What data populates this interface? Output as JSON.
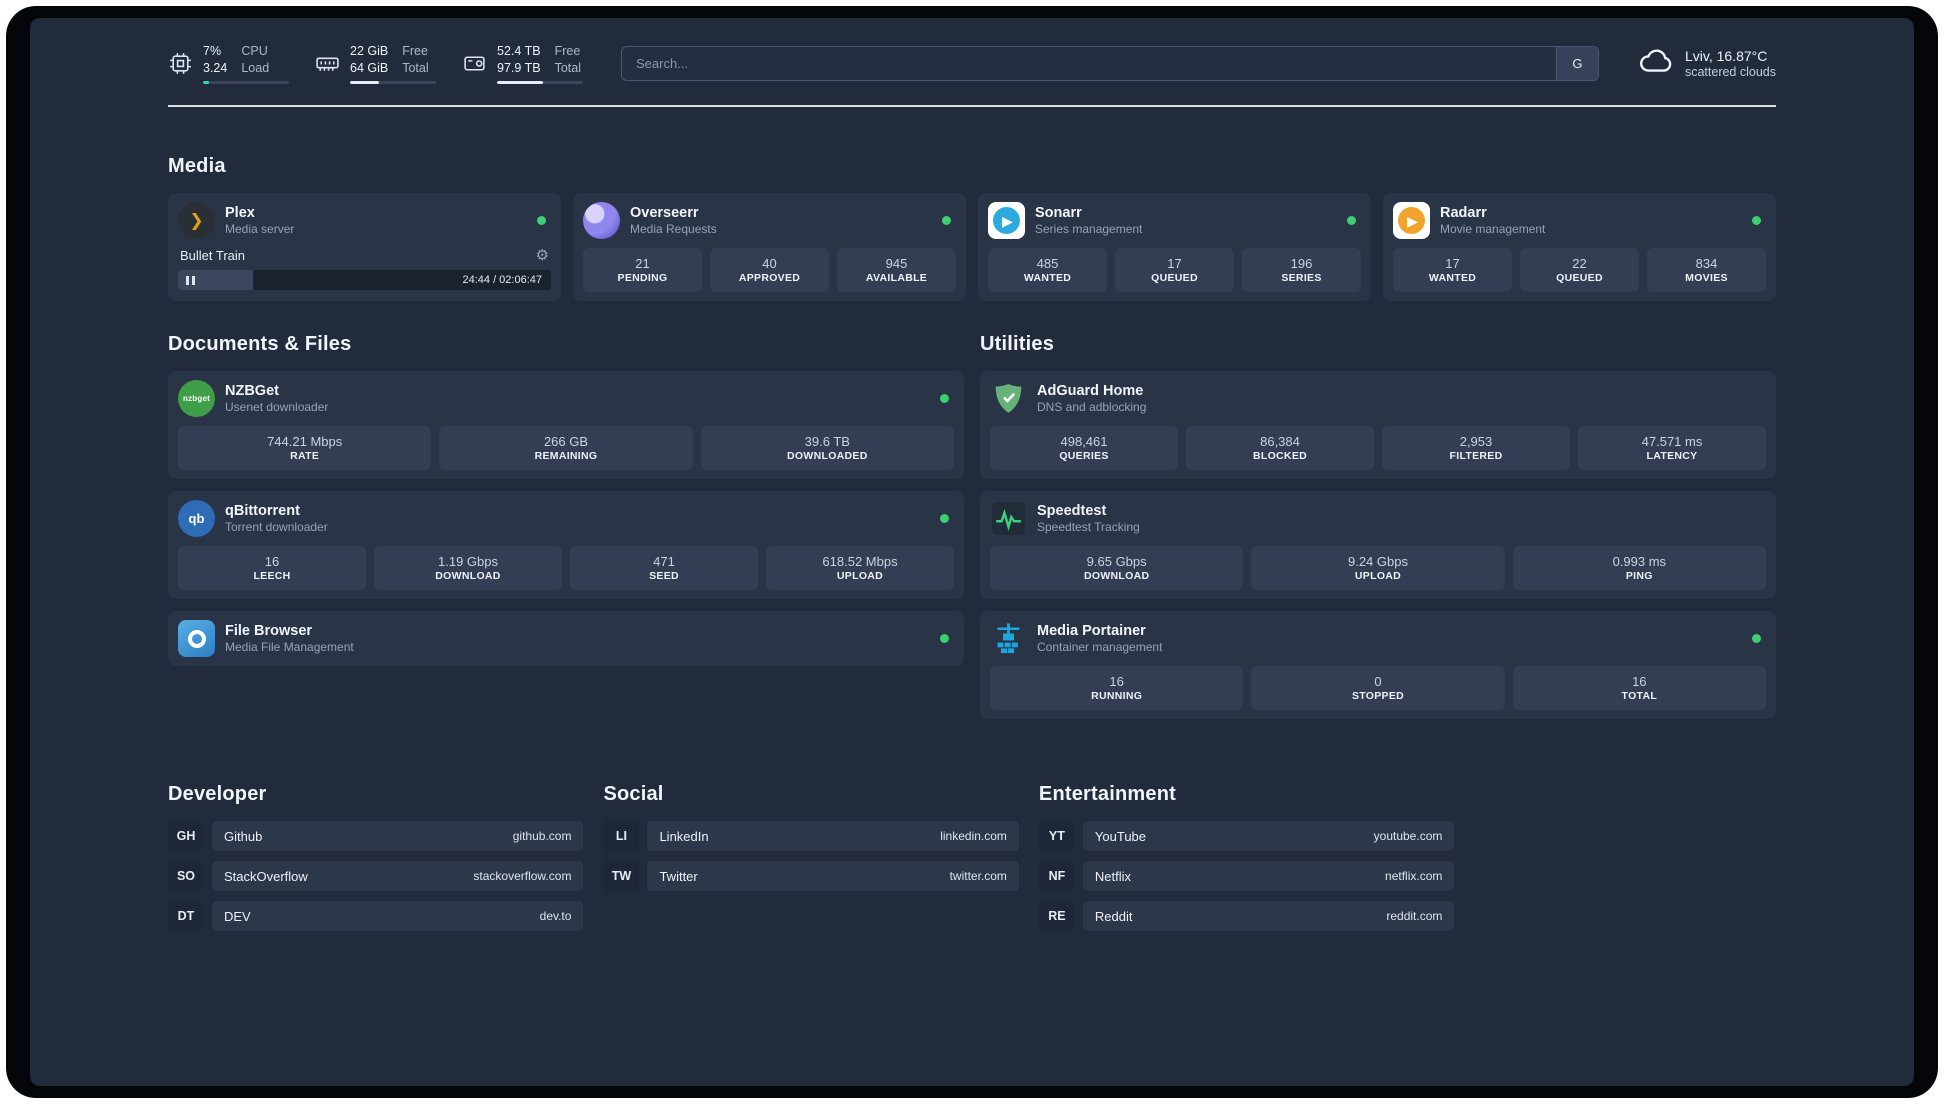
{
  "theme": {
    "status_green": "#3ecf72",
    "cpu_bar_color": "#2fd3b0",
    "ram_bar_color": "#e8edf5",
    "disk_bar_color": "#e8edf5"
  },
  "topbar": {
    "cpu": {
      "line1": "7%",
      "line2": "3.24",
      "label1": "CPU",
      "label2": "Load",
      "progress_pct": 7
    },
    "ram": {
      "line1": "22 GiB",
      "line2": "64 GiB",
      "label1": "Free",
      "label2": "Total",
      "progress_pct": 34
    },
    "disk": {
      "line1": "52.4 TB",
      "line2": "97.9 TB",
      "label1": "Free",
      "label2": "Total",
      "progress_pct": 53
    },
    "search": {
      "placeholder": "Search...",
      "engine_label": "G"
    },
    "weather": {
      "location": "Lviv, 16.87°C",
      "condition": "scattered clouds"
    }
  },
  "sections": {
    "media": {
      "title": "Media",
      "plex": {
        "title": "Plex",
        "subtitle": "Media server",
        "player": {
          "track": "Bullet Train",
          "time": "24:44 / 02:06:47",
          "progress_pct": 20
        }
      },
      "overseerr": {
        "title": "Overseerr",
        "subtitle": "Media Requests",
        "stats": [
          {
            "value": "21",
            "label": "PENDING"
          },
          {
            "value": "40",
            "label": "APPROVED"
          },
          {
            "value": "945",
            "label": "AVAILABLE"
          }
        ]
      },
      "sonarr": {
        "title": "Sonarr",
        "subtitle": "Series management",
        "stats": [
          {
            "value": "485",
            "label": "WANTED"
          },
          {
            "value": "17",
            "label": "QUEUED"
          },
          {
            "value": "196",
            "label": "SERIES"
          }
        ]
      },
      "radarr": {
        "title": "Radarr",
        "subtitle": "Movie management",
        "stats": [
          {
            "value": "17",
            "label": "WANTED"
          },
          {
            "value": "22",
            "label": "QUEUED"
          },
          {
            "value": "834",
            "label": "MOVIES"
          }
        ]
      }
    },
    "documents": {
      "title": "Documents & Files",
      "nzbget": {
        "title": "NZBGet",
        "subtitle": "Usenet downloader",
        "stats": [
          {
            "value": "744.21 Mbps",
            "label": "RATE"
          },
          {
            "value": "266 GB",
            "label": "REMAINING"
          },
          {
            "value": "39.6 TB",
            "label": "DOWNLOADED"
          }
        ]
      },
      "qbittorrent": {
        "title": "qBittorrent",
        "subtitle": "Torrent downloader",
        "stats": [
          {
            "value": "16",
            "label": "LEECH"
          },
          {
            "value": "1.19 Gbps",
            "label": "DOWNLOAD"
          },
          {
            "value": "471",
            "label": "SEED"
          },
          {
            "value": "618.52 Mbps",
            "label": "UPLOAD"
          }
        ]
      },
      "filebrowser": {
        "title": "File Browser",
        "subtitle": "Media File Management"
      }
    },
    "utilities": {
      "title": "Utilities",
      "adguard": {
        "title": "AdGuard Home",
        "subtitle": "DNS and adblocking",
        "stats": [
          {
            "value": "498,461",
            "label": "QUERIES"
          },
          {
            "value": "86,384",
            "label": "BLOCKED"
          },
          {
            "value": "2,953",
            "label": "FILTERED"
          },
          {
            "value": "47.571 ms",
            "label": "LATENCY"
          }
        ]
      },
      "speedtest": {
        "title": "Speedtest",
        "subtitle": "Speedtest Tracking",
        "stats": [
          {
            "value": "9.65 Gbps",
            "label": "DOWNLOAD"
          },
          {
            "value": "9.24 Gbps",
            "label": "UPLOAD"
          },
          {
            "value": "0.993 ms",
            "label": "PING"
          }
        ]
      },
      "portainer": {
        "title": "Media Portainer",
        "subtitle": "Container management",
        "stats": [
          {
            "value": "16",
            "label": "RUNNING"
          },
          {
            "value": "0",
            "label": "STOPPED"
          },
          {
            "value": "16",
            "label": "TOTAL"
          }
        ]
      }
    }
  },
  "bookmarks": {
    "developer": {
      "title": "Developer",
      "items": [
        {
          "abbr": "GH",
          "name": "Github",
          "url": "github.com"
        },
        {
          "abbr": "SO",
          "name": "StackOverflow",
          "url": "stackoverflow.com"
        },
        {
          "abbr": "DT",
          "name": "DEV",
          "url": "dev.to"
        }
      ]
    },
    "social": {
      "title": "Social",
      "items": [
        {
          "abbr": "LI",
          "name": "LinkedIn",
          "url": "linkedin.com"
        },
        {
          "abbr": "TW",
          "name": "Twitter",
          "url": "twitter.com"
        }
      ]
    },
    "entertainment": {
      "title": "Entertainment",
      "items": [
        {
          "abbr": "YT",
          "name": "YouTube",
          "url": "youtube.com"
        },
        {
          "abbr": "NF",
          "name": "Netflix",
          "url": "netflix.com"
        },
        {
          "abbr": "RE",
          "name": "Reddit",
          "url": "reddit.com"
        }
      ]
    }
  },
  "icons": {
    "plex_glyph": "❯",
    "nzbget_text": "nzbget",
    "qbittorrent_text": "qb",
    "sonarr_glyph": "▶",
    "radarr_glyph": "▶",
    "gear_glyph": "⚙"
  }
}
